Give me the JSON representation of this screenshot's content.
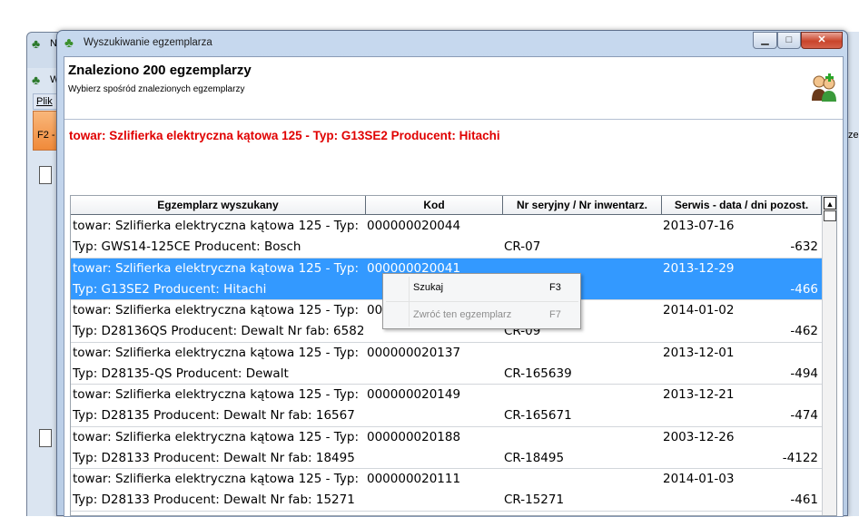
{
  "background": {
    "menu_label": "Plik",
    "f2_label": "F2 -",
    "title_fragment_1": "N",
    "title_fragment_2": "W",
    "right_fragment": "ze"
  },
  "dialog": {
    "title": "Wyszukiwanie egzemplarza",
    "minimize": "▁",
    "maximize": "□",
    "close": "✕"
  },
  "header": {
    "title": "Znaleziono 200 egzemplarzy",
    "subtitle": "Wybierz spośród znalezionych egzemplarzy"
  },
  "product_line": "towar: Szlifierka elektryczna kątowa 125 - Typ: G13SE2 Producent: Hitachi",
  "grid": {
    "columns": [
      {
        "label": "Egzemplarz wyszukany",
        "width": 325
      },
      {
        "label": "Kod",
        "width": 151
      },
      {
        "label": "Nr seryjny / Nr inwentarz.",
        "width": 175
      },
      {
        "label": "Serwis  -  data / dni pozost.",
        "width": 176
      }
    ],
    "rows": [
      {
        "line1": "towar: Szlifierka elektryczna kątowa 125 - Typ: GWS14-125CE",
        "line2": "Typ: GWS14-125CE Producent: Bosch",
        "kod": "000000020044",
        "serial": "CR-07",
        "date": "2013-07-16",
        "days": "-632",
        "selected": false
      },
      {
        "line1": "towar: Szlifierka elektryczna kątowa 125 - Typ: G13SE2",
        "line2": "Typ: G13SE2 Producent: Hitachi",
        "kod": "000000020041",
        "serial": "",
        "date": "2013-12-29",
        "days": "-466",
        "selected": true
      },
      {
        "line1": "towar: Szlifierka elektryczna kątowa 125 - Typ: D28136QS",
        "line2": "Typ: D28136QS Producent: Dewalt Nr fab: 6582",
        "kod": "000000020",
        "serial": "CR-09",
        "date": "2014-01-02",
        "days": "-462",
        "selected": false
      },
      {
        "line1": "towar: Szlifierka elektryczna kątowa 125 - Typ: D28135-QS",
        "line2": "Typ: D28135-QS Producent: Dewalt",
        "kod": "000000020137",
        "serial": "CR-165639",
        "date": "2013-12-01",
        "days": "-494",
        "selected": false
      },
      {
        "line1": "towar: Szlifierka elektryczna kątowa 125 - Typ: D28135",
        "line2": "Typ: D28135 Producent: Dewalt Nr fab: 16567",
        "kod": "000000020149",
        "serial": "CR-165671",
        "date": "2013-12-21",
        "days": "-474",
        "selected": false
      },
      {
        "line1": "towar: Szlifierka elektryczna kątowa 125 - Typ: D28133",
        "line2": "Typ: D28133 Producent: Dewalt Nr fab: 18495",
        "kod": "000000020188",
        "serial": "CR-18495",
        "date": "2003-12-26",
        "days": "-4122",
        "selected": false
      },
      {
        "line1": "towar: Szlifierka elektryczna kątowa 125 - Typ: D28133",
        "line2": "Typ: D28133 Producent: Dewalt Nr fab: 15271",
        "kod": "000000020111",
        "serial": "CR-15271",
        "date": "2014-01-03",
        "days": "-461",
        "selected": false
      }
    ]
  },
  "context_menu": {
    "items": [
      {
        "label": "Szukaj",
        "shortcut": "F3",
        "disabled": false
      },
      {
        "label": "Zwróć ten egzemplarz",
        "shortcut": "F7",
        "disabled": true
      }
    ]
  }
}
